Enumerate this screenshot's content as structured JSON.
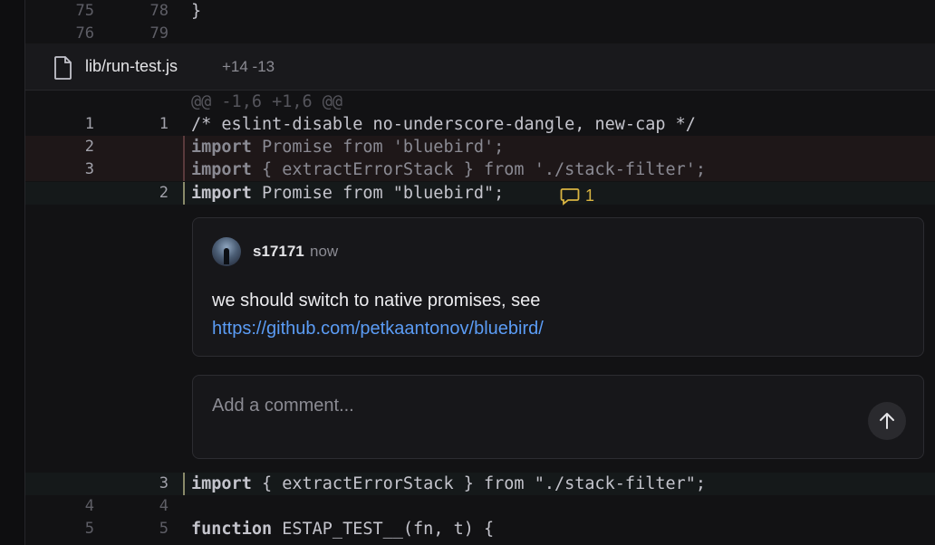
{
  "colors": {
    "deleted_bar": "#5a3a3c",
    "added_bar": "#8a8a6a",
    "link": "#5b9cf5",
    "comment_badge": "#d9b441"
  },
  "top_lines": [
    {
      "old": "75",
      "new": "78",
      "code": "}"
    },
    {
      "old": "76",
      "new": "79",
      "code": ""
    }
  ],
  "file": {
    "icon": "file-icon",
    "name": "lib/run-test.js",
    "stats": "+14 -13"
  },
  "hunk_header": "@@ -1,6 +1,6 @@",
  "lines": {
    "l1": {
      "old": "1",
      "new": "1",
      "code": "/* eslint-disable no-underscore-dangle, new-cap */"
    },
    "d2": {
      "old": "2",
      "kw": "import",
      "rest": " Promise from 'bluebird';"
    },
    "d3": {
      "old": "3",
      "kw": "import",
      "rest": " { extractErrorStack } from './stack-filter';"
    },
    "a2": {
      "new": "2",
      "kw": "import",
      "rest": " Promise from \"bluebird\";",
      "comment_count": "1"
    },
    "a3": {
      "new": "3",
      "kw": "import",
      "rest": " { extractErrorStack } from \"./stack-filter\";"
    },
    "l4": {
      "old": "4",
      "new": "4",
      "code": ""
    },
    "l5": {
      "old": "5",
      "new": "5",
      "kw": "function",
      "rest": " ESTAP_TEST__(fn, t) {"
    }
  },
  "comment": {
    "user": "s17171",
    "time": "now",
    "text": "we should switch to native promises, see",
    "link": "https://github.com/petkaantonov/bluebird/"
  },
  "reply": {
    "placeholder": "Add a comment..."
  }
}
